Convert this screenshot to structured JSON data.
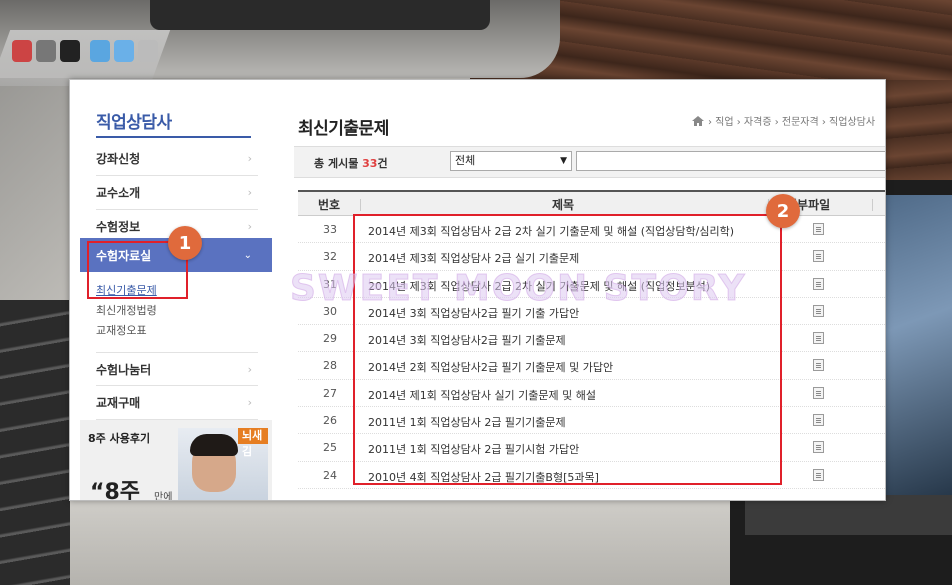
{
  "sidebar": {
    "title": "직업상담사",
    "items": [
      {
        "label": "강좌신청"
      },
      {
        "label": "교수소개"
      },
      {
        "label": "수험정보"
      },
      {
        "label": "수험자료실"
      },
      {
        "label": "수험나눔터"
      },
      {
        "label": "교재구매"
      }
    ],
    "submenu": [
      "최신기출문제",
      "최신개정법령",
      "교재정오표"
    ],
    "review": {
      "title": "8주 사용후기",
      "badge": "뇌새김",
      "quote": "“8주",
      "small": "만에"
    }
  },
  "main": {
    "title": "최신기출문제",
    "breadcrumb": "› 직업 › 자격증 › 전문자격 › 직업상담사",
    "total_label": "총 게시물",
    "total_count": "33",
    "total_suffix": "건",
    "filter_selected": "전체",
    "table": {
      "headers": [
        "번호",
        "제목",
        "첨부파일"
      ],
      "rows": [
        {
          "num": "33",
          "title": "2014년 제3회 직업상담사 2급 2차 실기 기출문제 및 해설 (직업상담학/심리학)"
        },
        {
          "num": "32",
          "title": "2014년 제3회 직업상담사 2급 실기 기출문제"
        },
        {
          "num": "31",
          "title": "2014년 제3회 직업상담사 2급 2차 실기 기출문제 및 해설 (직업정보분석)"
        },
        {
          "num": "30",
          "title": "2014년 3회 직업상담사2급 필기 기출 가답안"
        },
        {
          "num": "29",
          "title": "2014년 3회 직업상담사2급 필기 기출문제"
        },
        {
          "num": "28",
          "title": "2014년 2회 직업상담사2급 필기 기출문제 및 가답안"
        },
        {
          "num": "27",
          "title": "2014년 제1회 직업상담사 실기 기출문제 및 해설"
        },
        {
          "num": "26",
          "title": "2011년 1회 직업상담사 2급 필기기출문제"
        },
        {
          "num": "25",
          "title": "2011년 1회 직업상담사 2급 필기시험 가답안"
        },
        {
          "num": "24",
          "title": "2010년 4회 직업상담사 2급 필기기출B형[5과목]"
        }
      ]
    }
  },
  "annotations": [
    "1",
    "2"
  ],
  "watermark": "SWEET MOON STORY",
  "colors": {
    "accent": "#3a5ba8",
    "active_menu": "#5a72c0",
    "annotation": "#e0202a",
    "badge": "#e06a3c"
  }
}
